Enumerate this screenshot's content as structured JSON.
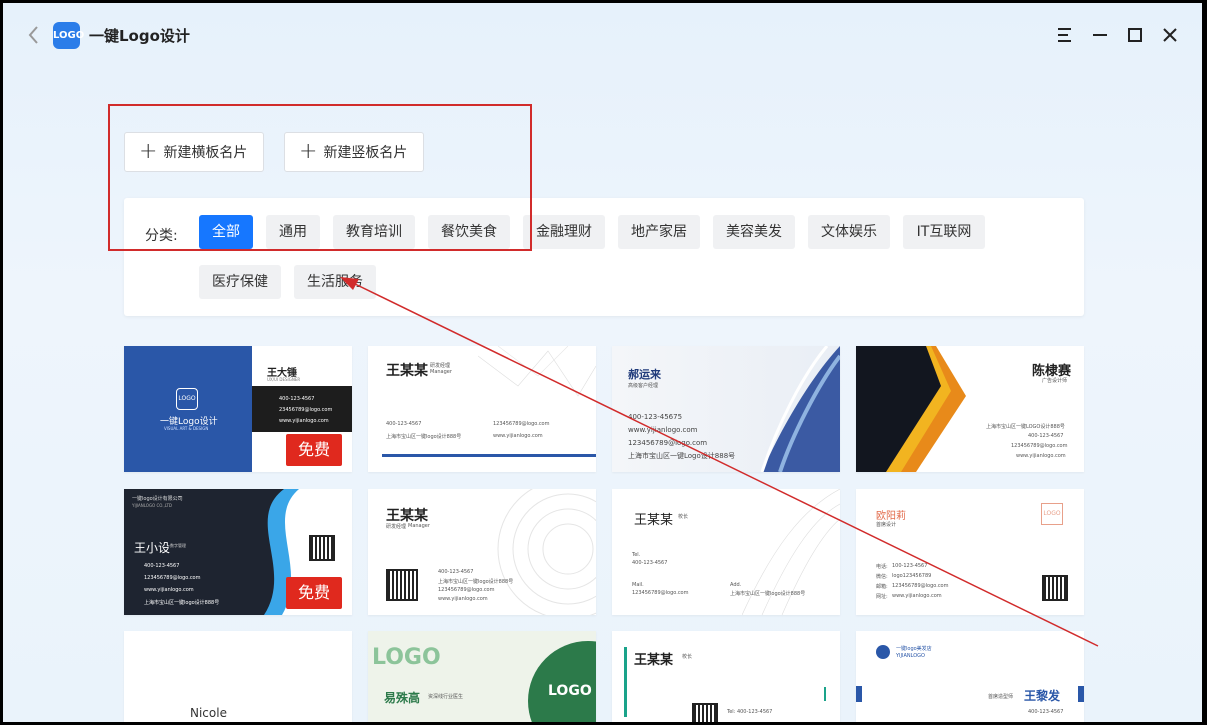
{
  "app": {
    "title": "一键Logo设计",
    "logo_text": "LOGO",
    "icons": {
      "back": "chevron-left-icon",
      "menu": "menu-icon",
      "minimize": "minimize-icon",
      "maximize": "maximize-icon",
      "close": "close-icon"
    }
  },
  "actions": {
    "new_horizontal": "新建横板名片",
    "new_vertical": "新建竖板名片"
  },
  "filter": {
    "label": "分类:",
    "active": "全部",
    "categories": [
      "全部",
      "通用",
      "教育培训",
      "餐饮美食",
      "金融理财",
      "地产家居",
      "美容美发",
      "文体娱乐",
      "IT互联网",
      "医疗保健",
      "生活服务"
    ]
  },
  "badge_free": "免费",
  "accent_color": "#1677ff",
  "annotation_color": "#d12b2b",
  "cards": [
    {
      "name": "王大锤",
      "role": "UX/UI DESIGNER",
      "brand": "一键Logo设计",
      "brand_sub": "VISUAL ART & DESIGN",
      "phone": "400-123-4567",
      "email": "23456789@logo.com",
      "web": "www.yijianlogo.com",
      "addr": "上海市宝山区一键LOGO设计888号",
      "free": true
    },
    {
      "name": "王某某",
      "role": "研发经理",
      "role_en": "Manager",
      "phone": "400-123-4567",
      "email": "123456789@logo.com",
      "addr": "上海市宝山区一键logo设计888号",
      "web": "www.yijianlogo.com"
    },
    {
      "name": "郝运来",
      "role": "高级客户经理",
      "phone": "400-123-45675",
      "web": "www.yijianlogo.com",
      "email": "123456789@logo.com",
      "addr": "上海市宝山区一键Logo设计888号"
    },
    {
      "name": "陈棣赛",
      "role": "广告设计师",
      "addr": "上海市宝山区一键LOGO设计888号",
      "phone": "400-123-4567",
      "email": "123456789@logo.com",
      "web": "www.yijianlogo.com"
    },
    {
      "company": "一键logo设计有限公司",
      "company_en": "YIJIANLOGO CO.,LTD",
      "name": "王小设",
      "role": "数字管理",
      "phone": "400-123-4567",
      "email": "123456789@logo.com",
      "web": "www.yijianlogo.com",
      "addr": "上海市宝山区一键logo设计888号",
      "free": true
    },
    {
      "name": "王某某",
      "role": "研发经理",
      "role_en": "Manager",
      "phone": "400-123-4567",
      "addr": "上海市宝山区一键logo设计888号",
      "email": "123456789@logo.com",
      "web": "www.yijianlogo.com"
    },
    {
      "name": "王某某",
      "role": "校长",
      "tel_label": "Tel.",
      "phone": "400-123-4567",
      "mail_label": "Mail.",
      "email": "123456789@logo.com",
      "add_label": "Add.",
      "addr": "上海市宝山区一键logo设计888号"
    },
    {
      "name": "欧阳莉",
      "role": "首席设计",
      "phone_label": "电话:",
      "phone": "100-123-4567",
      "wechat_label": "微信:",
      "wechat": "logo123456789",
      "email_label": "邮箱:",
      "email": "123456789@logo.com",
      "web_label": "网址:",
      "web": "www.yijianlogo.com"
    },
    {
      "name": "Nicole"
    },
    {
      "name": "易殊高",
      "role": "资深线行业医生",
      "logo_text": "LOGO"
    },
    {
      "name": "王某某",
      "role": "校长",
      "phone": "Tel: 400-123-4567"
    },
    {
      "brand": "一键logo美发店",
      "brand_en": "YIJIANLOGO",
      "name": "王黎发",
      "role": "首席造型师",
      "phone": "400-123-4567"
    }
  ]
}
